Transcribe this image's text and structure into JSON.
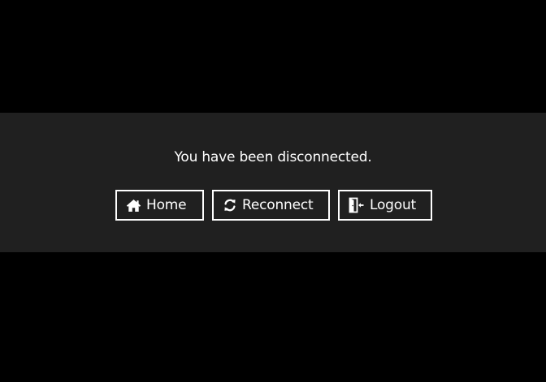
{
  "message": "You have been disconnected.",
  "buttons": {
    "home": {
      "label": "Home",
      "icon": "home-icon"
    },
    "reconnect": {
      "label": "Reconnect",
      "icon": "refresh-icon"
    },
    "logout": {
      "label": "Logout",
      "icon": "door-exit-icon"
    }
  },
  "colors": {
    "page_background": "#000000",
    "dialog_background": "#202020",
    "text": "#ffffff",
    "button_border": "#ffffff"
  }
}
